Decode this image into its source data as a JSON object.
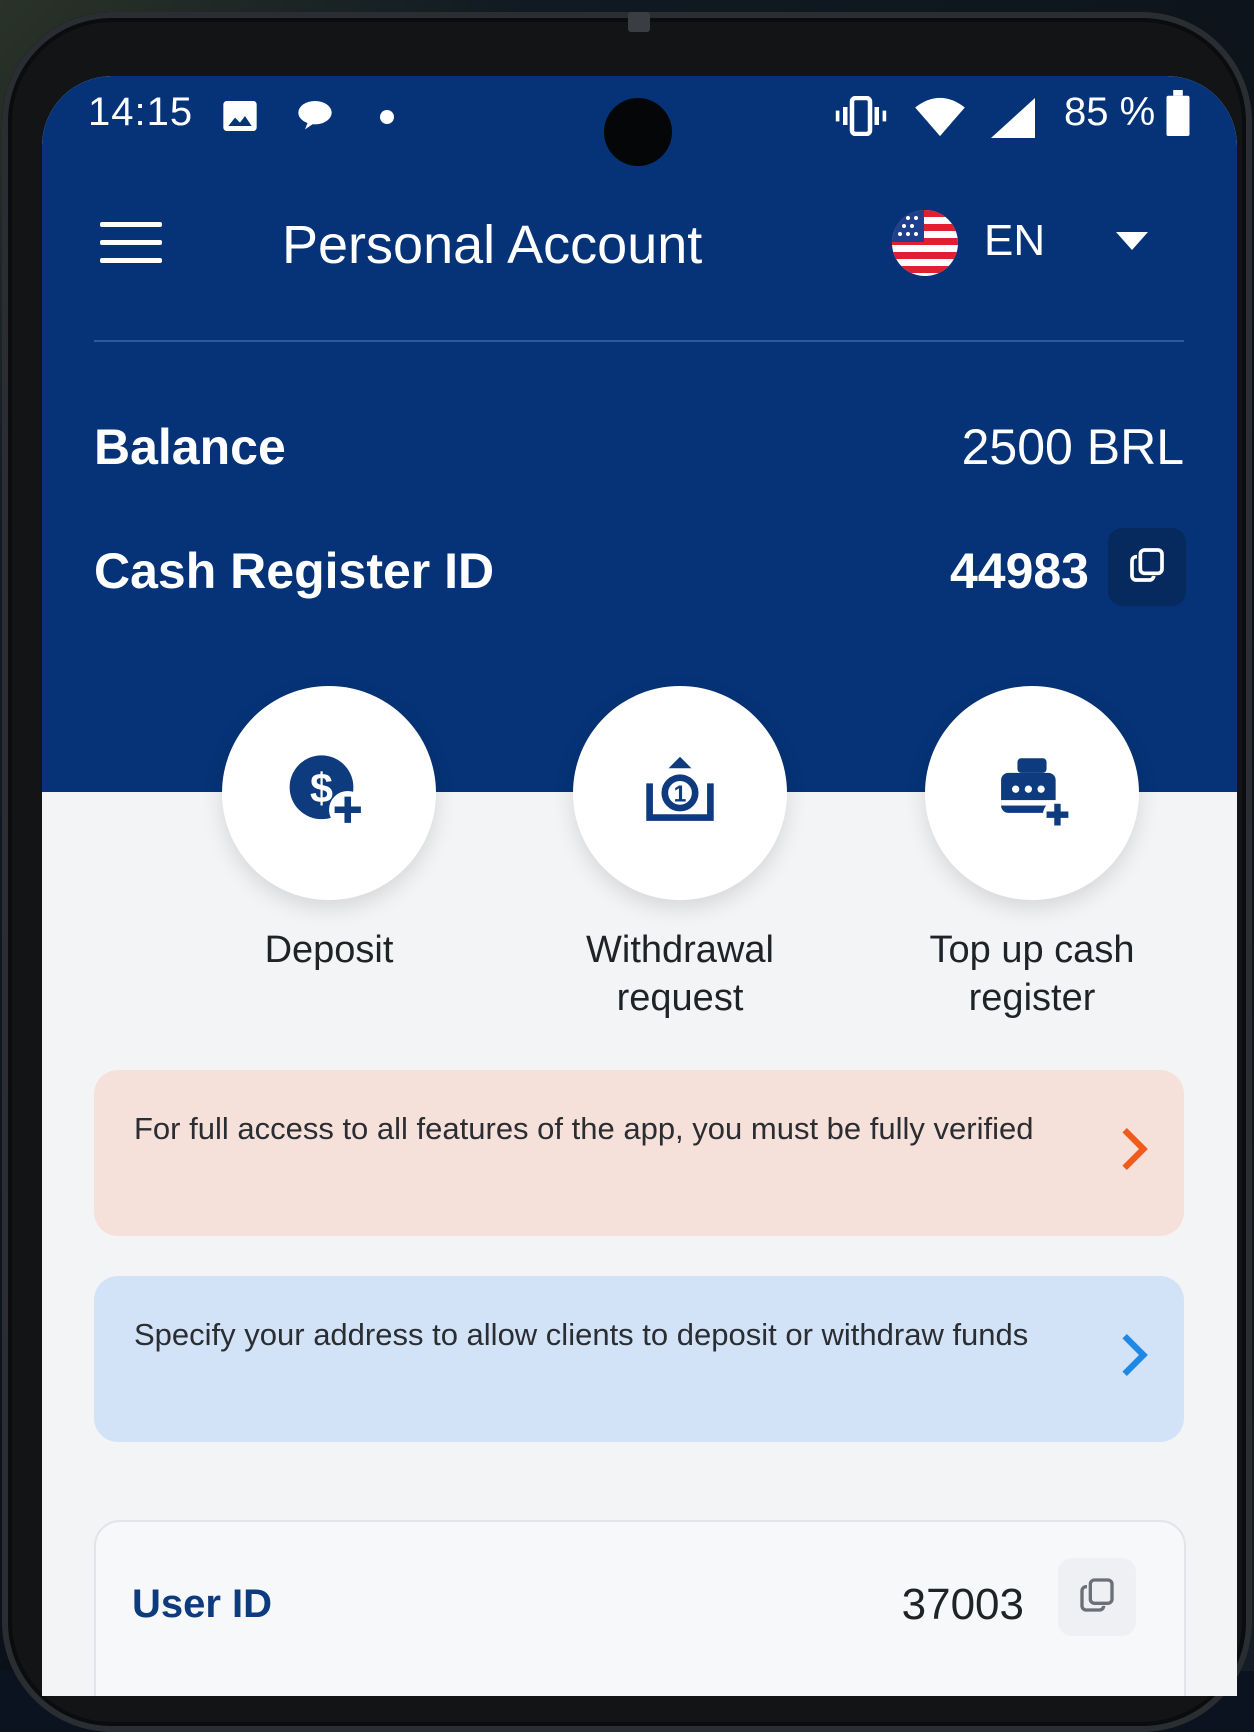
{
  "status_bar": {
    "time": "14:15",
    "battery_percent": "85 %",
    "icons": [
      "image-icon",
      "chat-bubble-icon",
      "notification-dot-icon",
      "vibrate-icon",
      "wifi-icon",
      "signal-icon",
      "battery-icon"
    ]
  },
  "header": {
    "title": "Personal Account",
    "language_code": "EN",
    "flag": "us-flag-icon"
  },
  "account": {
    "balance_label": "Balance",
    "balance_value": "2500 BRL",
    "cash_register_label": "Cash Register ID",
    "cash_register_value": "44983"
  },
  "actions": [
    {
      "label": "Deposit",
      "icon": "dollar-plus-icon"
    },
    {
      "label": "Withdrawal request",
      "icon": "withdraw-cash-icon"
    },
    {
      "label": "Top up cash register",
      "icon": "cash-register-plus-icon"
    }
  ],
  "banners": {
    "verification": "For full access to all features of the app, you must be fully verified",
    "address": "Specify your address to allow clients to deposit or withdraw funds"
  },
  "user_card": {
    "label": "User ID",
    "value": "37003"
  },
  "colors": {
    "primary": "#063377",
    "warning_bg": "#f6e0da",
    "warning_accent": "#f05a1a",
    "info_bg": "#d3e3f7",
    "info_accent": "#1e88e5"
  }
}
